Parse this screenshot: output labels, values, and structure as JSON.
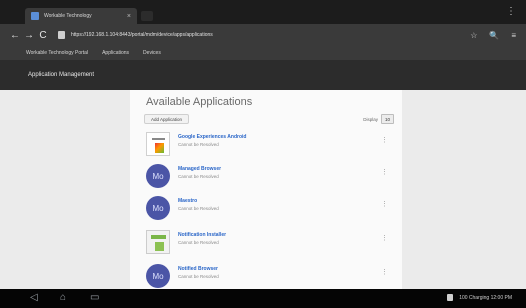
{
  "browser": {
    "tab_title": "Workable Technology",
    "tab_close": "×",
    "menu_glyph": "⋮",
    "back_glyph": "←",
    "forward_glyph": "→",
    "reload_glyph": "C",
    "url": "https://192.168.1.104:8443/portal/mdm/device/apps/applications",
    "bookmarks": [
      "Workable Technology Portal",
      "Applications",
      "Devices"
    ],
    "action_glyphs": [
      "☆",
      "🔍",
      "≡"
    ]
  },
  "app_header": {
    "title": "Application Management"
  },
  "page": {
    "title": "Available Applications",
    "add_button": "Add Application",
    "display_label": "Display",
    "display_value": "10",
    "apps": [
      {
        "name": "Google Experiences Android",
        "publisher": "Cannot be Resolved",
        "icon": "document-chart-icon",
        "glyph": ""
      },
      {
        "name": "Managed Browser",
        "publisher": "Cannot be Resolved",
        "icon": "mobiliti-icon",
        "glyph": "Mo"
      },
      {
        "name": "Maestro",
        "publisher": "Cannot be Resolved",
        "icon": "mobiliti-icon",
        "glyph": "Mo"
      },
      {
        "name": "Notification Installer",
        "publisher": "Cannot be Resolved",
        "icon": "installer-icon",
        "glyph": ""
      },
      {
        "name": "Notified Browser",
        "publisher": "Cannot be Resolved",
        "icon": "mobiliti-icon",
        "glyph": "Mo"
      }
    ],
    "row_menu_glyph": "⋮"
  },
  "system_bar": {
    "back_glyph": "◁",
    "home_glyph": "⌂",
    "recent_glyph": "▭",
    "status_text": "100 Charging 12:00 PM"
  }
}
